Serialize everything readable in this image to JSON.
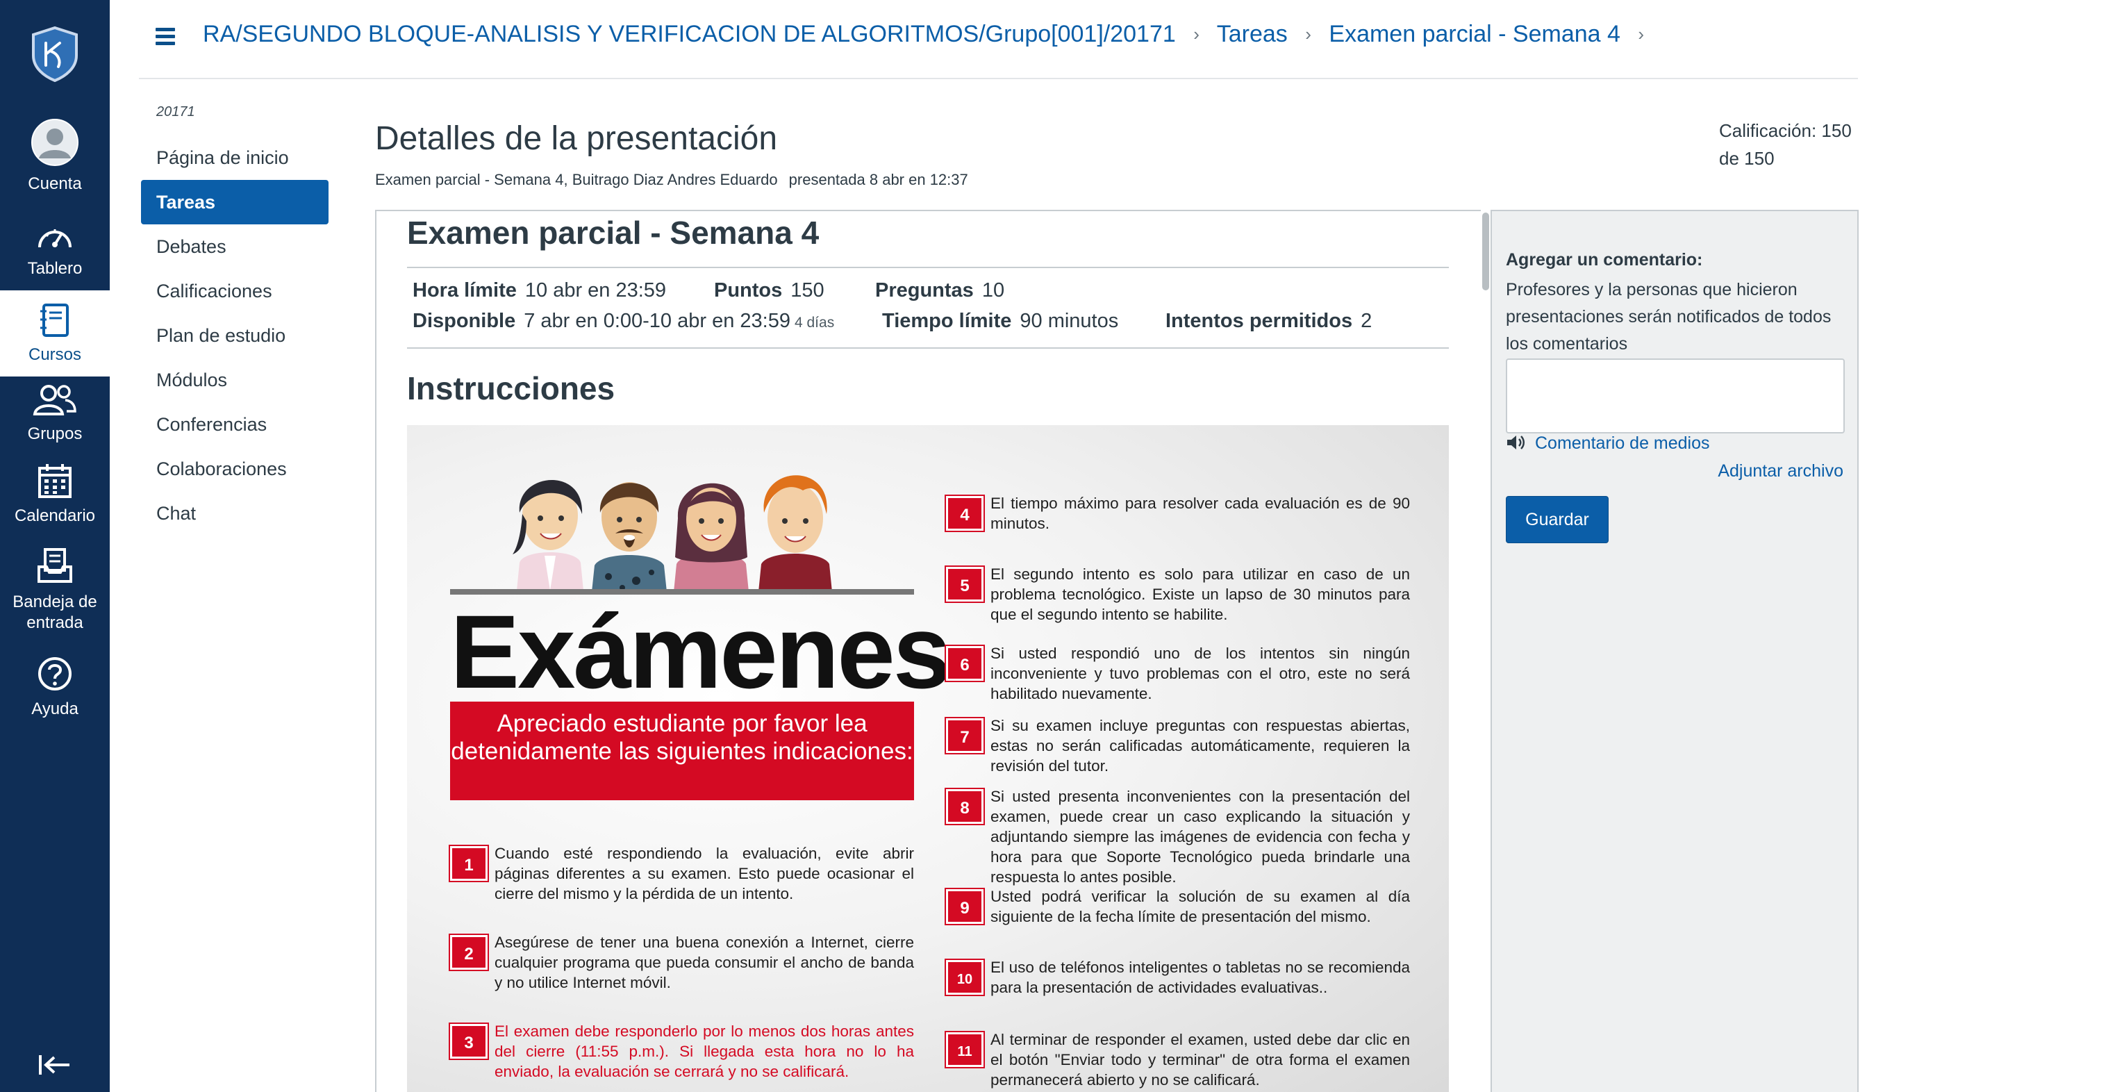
{
  "global_nav": {
    "logo_icon": "university-shield-logo",
    "items": [
      {
        "label": "Cuenta",
        "icon": "avatar-icon"
      },
      {
        "label": "Tablero",
        "icon": "dashboard-gauge-icon"
      },
      {
        "label": "Cursos",
        "icon": "courses-book-icon"
      },
      {
        "label": "Grupos",
        "icon": "groups-icon"
      },
      {
        "label": "Calendario",
        "icon": "calendar-icon"
      },
      {
        "label": "Bandeja de entrada",
        "icon": "inbox-icon"
      },
      {
        "label": "Ayuda",
        "icon": "help-icon"
      }
    ],
    "collapse_icon": "collapse-nav-icon",
    "colors": {
      "background": "#0f2e56",
      "active_text": "#0b4f8a"
    }
  },
  "breadcrumb": {
    "items": [
      "RA/SEGUNDO BLOQUE-ANALISIS Y VERIFICACION DE ALGORITMOS/Grupo[001]/20171",
      "Tareas",
      "Examen parcial - Semana 4"
    ],
    "separator": "›"
  },
  "course_nav": {
    "term": "20171",
    "items": [
      "Página de inicio",
      "Tareas",
      "Debates",
      "Calificaciones",
      "Plan de estudio",
      "Módulos",
      "Conferencias",
      "Colaboraciones",
      "Chat"
    ],
    "active": "Tareas"
  },
  "submission": {
    "title": "Detalles de la presentación",
    "subtitle": "Examen parcial - Semana 4, Buitrago Diaz Andres Eduardo",
    "submitted": "presentada 8 abr en 12:37",
    "grade_line1": "Calificación: 150",
    "grade_line2": "de 150"
  },
  "quiz": {
    "title": "Examen parcial - Semana 4",
    "details": {
      "due_label": "Hora límite",
      "due_value": "10 abr en 23:59",
      "points_label": "Puntos",
      "points_value": "150",
      "questions_label": "Preguntas",
      "questions_value": "10",
      "available_label": "Disponible",
      "available_value": "7 abr en 0:00-10 abr en 23:59",
      "available_days": "4 días",
      "time_limit_label": "Tiempo límite",
      "time_limit_value": "90 minutos",
      "attempts_label": "Intentos permitidos",
      "attempts_value": "2"
    },
    "instructions_heading": "Instrucciones"
  },
  "poster": {
    "title": "Exámenes",
    "banner": "Apreciado estudiante por favor lea detenidamente las siguientes indicaciones:",
    "accent_color": "#d40a23",
    "items_left": [
      {
        "n": "1",
        "text": "Cuando esté respondiendo la evaluación, evite abrir páginas diferentes a su examen. Esto puede ocasionar el cierre del mismo y la pérdida de un intento."
      },
      {
        "n": "2",
        "text": "Asegúrese de tener una buena conexión a Internet, cierre cualquier programa que pueda consumir el ancho de banda y no utilice Internet móvil."
      },
      {
        "n": "3",
        "text": "El examen debe responderlo por lo menos dos horas antes del cierre (11:55 p.m.). Si llegada esta hora no lo ha enviado, la evaluación se cerrará y no se calificará."
      }
    ],
    "items_right": [
      {
        "n": "4",
        "text": "El tiempo máximo para resolver cada evaluación es de 90 minutos."
      },
      {
        "n": "5",
        "text": "El segundo intento es solo para utilizar en caso de un problema tecnológico. Existe un lapso de 30 minutos para que el segundo intento se habilite."
      },
      {
        "n": "6",
        "text": "Si usted respondió uno de los intentos sin ningún inconveniente y tuvo problemas con el otro, este no será habilitado nuevamente."
      },
      {
        "n": "7",
        "text": "Si su examen incluye preguntas con respuestas abiertas, estas no serán calificadas automáticamente, requieren la revisión del tutor."
      },
      {
        "n": "8",
        "text": "Si usted presenta inconvenientes con la presentación del examen, puede crear un caso explicando la situación y adjuntando siempre las imágenes de evidencia con fecha y hora para que Soporte Tecnológico pueda brindarle una respuesta lo antes posible."
      },
      {
        "n": "9",
        "text": "Usted podrá verificar la solución de su examen al día siguiente de la fecha límite de presentación del mismo."
      },
      {
        "n": "10",
        "text": "El uso de teléfonos inteligentes o tabletas no se recomienda para la presentación de actividades evaluativas.."
      },
      {
        "n": "11",
        "text": "Al terminar de responder el examen, usted debe dar clic en el botón \"Enviar todo y terminar\" de otra forma el examen permanecerá abierto y no se calificará."
      }
    ]
  },
  "comments": {
    "label": "Agregar un comentario:",
    "help": "Profesores y la personas que hicieron presentaciones serán notificados de todos los comentarios",
    "textarea_value": "",
    "media_link": "Comentario de medios",
    "media_icon": "speaker-icon",
    "attach_link": "Adjuntar archivo",
    "save_button": "Guardar"
  }
}
